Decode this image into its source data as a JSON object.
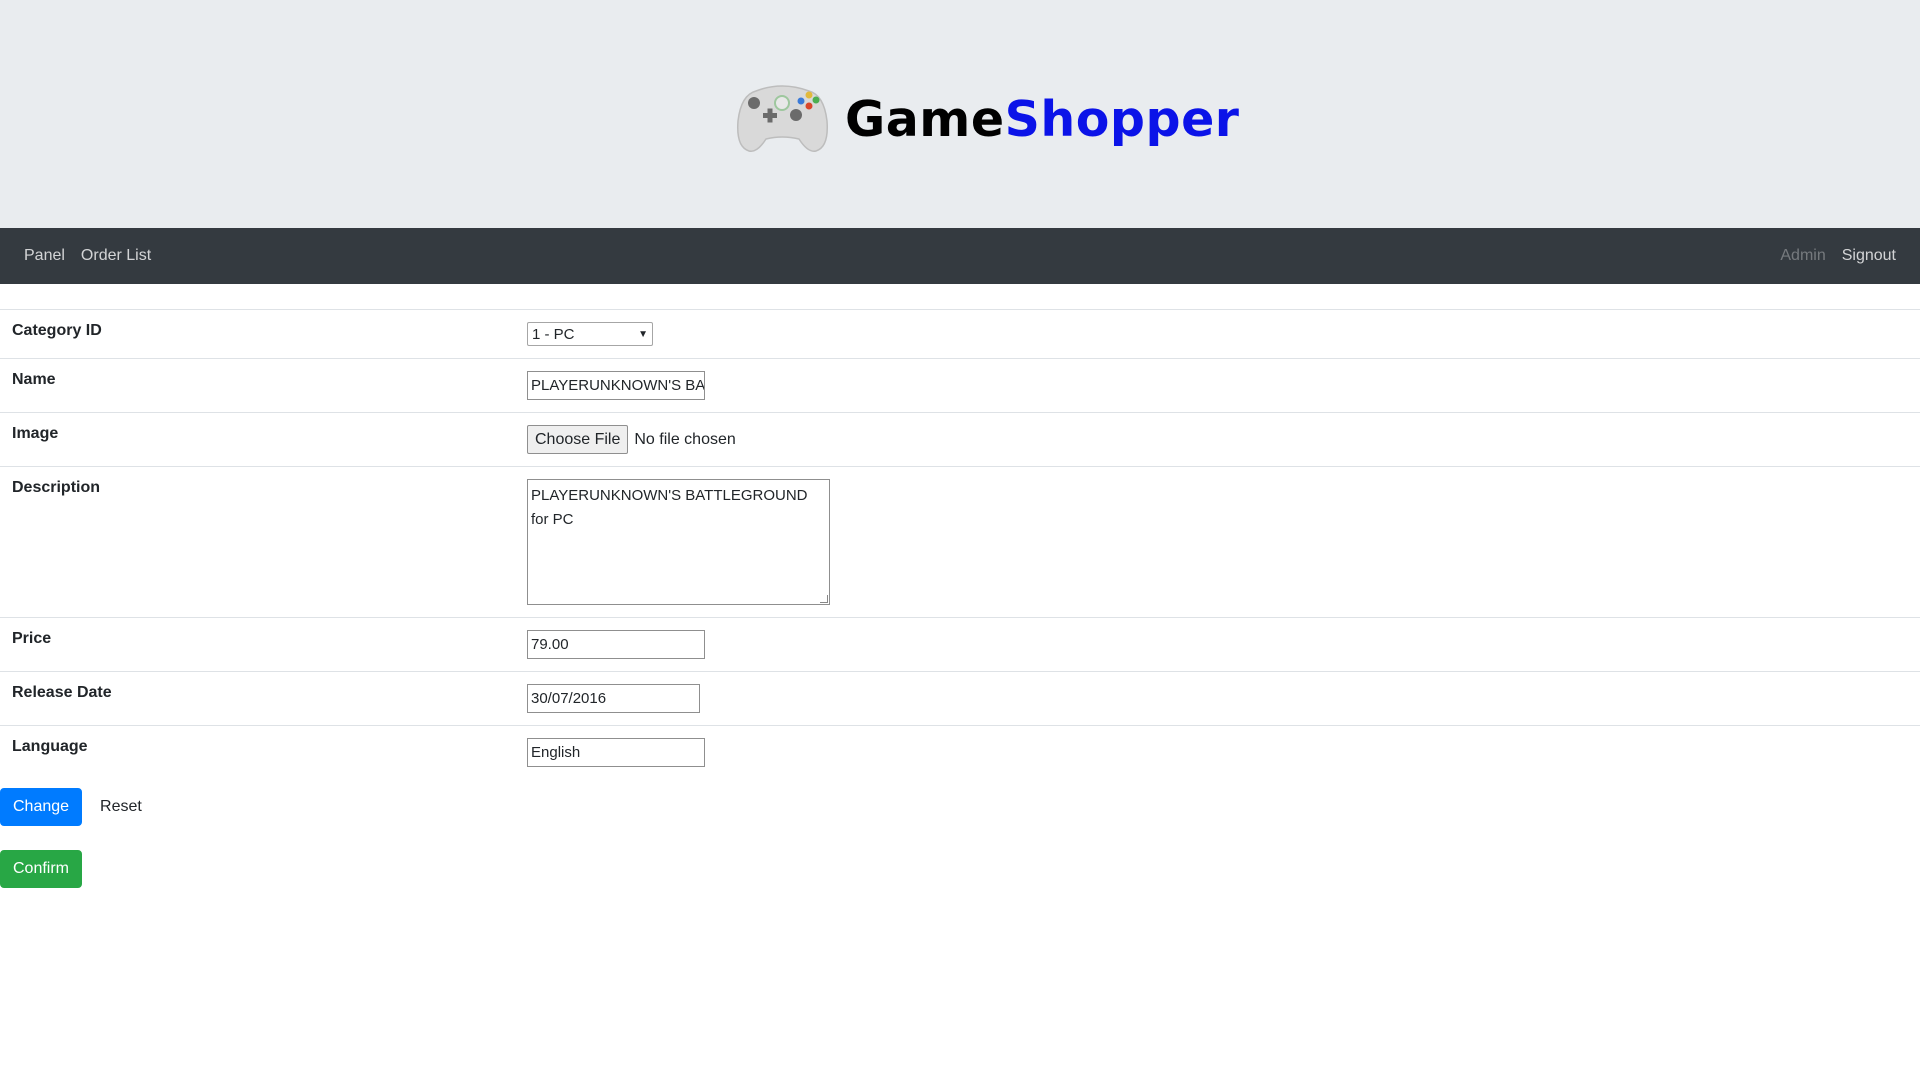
{
  "header": {
    "brand_part1": "Game",
    "brand_part2": "Shopper",
    "logo_icon": "gamepad-icon",
    "brand_color_primary": "#000000",
    "brand_color_accent": "#0b13e8"
  },
  "nav": {
    "left": [
      "Panel",
      "Order List"
    ],
    "right": [
      "Admin",
      "Signout"
    ]
  },
  "form": {
    "category": {
      "label": "Category ID",
      "value": "1 - PC"
    },
    "name": {
      "label": "Name",
      "value": "PLAYERUNKNOWN'S BAT"
    },
    "image": {
      "label": "Image",
      "button": "Choose File",
      "status": "No file chosen"
    },
    "description": {
      "label": "Description",
      "value": "PLAYERUNKNOWN'S BATTLEGROUND for PC"
    },
    "price": {
      "label": "Price",
      "value": "79.00"
    },
    "release_date": {
      "label": "Release Date",
      "value": "30/07/2016"
    },
    "language": {
      "label": "Language",
      "value": "English"
    }
  },
  "actions": {
    "change": "Change",
    "reset": "Reset",
    "confirm": "Confirm"
  },
  "colors": {
    "primary": "#007bff",
    "success": "#28a745",
    "navbar": "#343a40",
    "header_bg": "#e9ecef"
  }
}
